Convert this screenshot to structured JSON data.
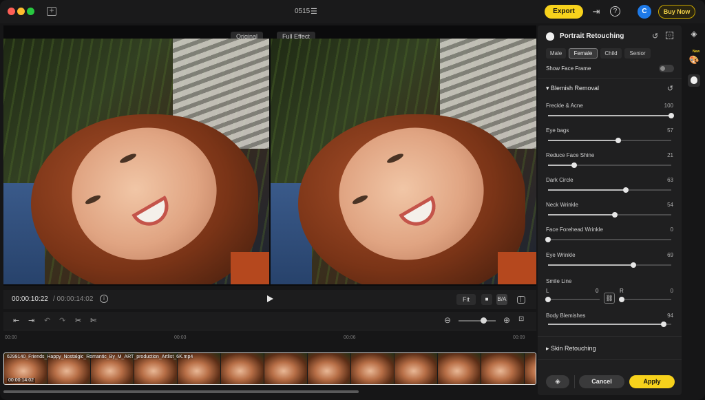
{
  "titlebar": {
    "project_name": "0515",
    "export_label": "Export",
    "avatar_letter": "C",
    "buy_now_label": "Buy Now"
  },
  "preview": {
    "original_label": "Original",
    "full_effect_label": "Full Effect"
  },
  "transport": {
    "current_time": "00:00:10:22",
    "total_time": "/ 00:00:14:02",
    "fit_label": "Fit",
    "compare_label": "B/A"
  },
  "timeline": {
    "ruler": [
      "00:00",
      "00:03",
      "00:06",
      "00:09"
    ],
    "clip_name": "6299140_Friends_Happy_Nostalgic_Romantic_By_M_ART_production_Artlist_6K.mp4",
    "clip_duration": "00:00:14:02",
    "zoom_level": 0.66
  },
  "panel": {
    "title": "Portrait Retouching",
    "genders": [
      "Male",
      "Female",
      "Child",
      "Senior"
    ],
    "selected_gender": "Female",
    "show_face_frame_label": "Show Face Frame",
    "show_face_frame_on": false,
    "blemish_section": "Blemish Removal",
    "sliders": [
      {
        "label": "Freckle & Acne",
        "value": "100",
        "pct": 100
      },
      {
        "label": "Eye bags",
        "value": "57",
        "pct": 57
      },
      {
        "label": "Reduce Face Shine",
        "value": "21",
        "pct": 21
      },
      {
        "label": "Dark Circle",
        "value": "63",
        "pct": 63
      },
      {
        "label": "Neck Wrinkle",
        "value": "54",
        "pct": 54
      },
      {
        "label": "Face Forehead Wrinkle",
        "value": "0",
        "pct": 0
      },
      {
        "label": "Eye Wrinkle",
        "value": "69",
        "pct": 69
      }
    ],
    "smile_line": {
      "label": "Smile Line",
      "left_label": "L",
      "left_value": "0",
      "right_label": "R",
      "right_value": "0"
    },
    "body_blemishes": {
      "label": "Body Blemishes",
      "value": "94",
      "pct": 94
    },
    "skin_section": "Skin Retouching",
    "cancel_label": "Cancel",
    "apply_label": "Apply"
  },
  "strip": {
    "new_badge": "New"
  },
  "colors": {
    "accent": "#f7d21c",
    "avatar": "#1e7ae8"
  }
}
